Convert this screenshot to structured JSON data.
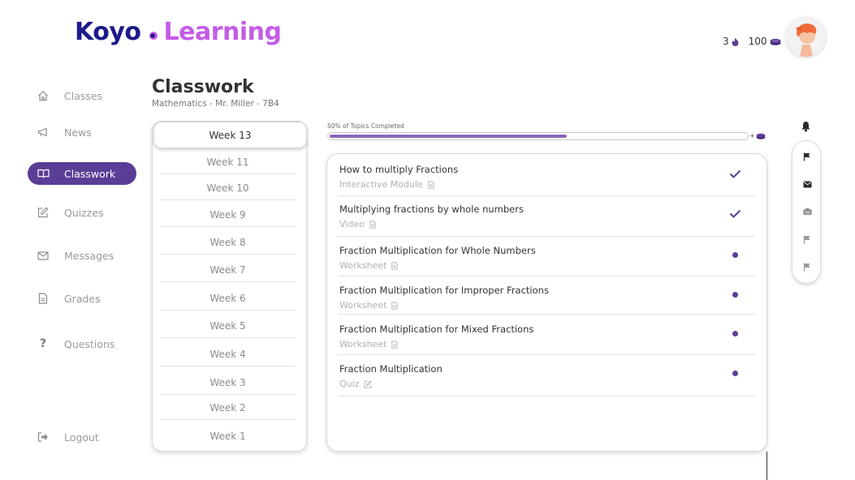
{
  "brand": {
    "part1": "Koyo",
    "part2": "Learning",
    "color1": "#1d1a8c",
    "color2": "#c35ce6"
  },
  "header": {
    "streak": "3",
    "streak_icon": "flame-icon",
    "coins": "100",
    "coin_icon": "coin-icon"
  },
  "sidebar": {
    "items": [
      {
        "label": "Classes",
        "icon": "home-icon",
        "active": false
      },
      {
        "label": "News",
        "icon": "megaphone-icon",
        "active": false
      },
      {
        "label": "Classwork",
        "icon": "book-icon",
        "active": true
      },
      {
        "label": "Quizzes",
        "icon": "edit-icon",
        "active": false
      },
      {
        "label": "Messages",
        "icon": "envelope-icon",
        "active": false
      },
      {
        "label": "Grades",
        "icon": "document-icon",
        "active": false
      },
      {
        "label": "Questions",
        "icon": "question-icon",
        "active": false
      }
    ],
    "logout": "Logout"
  },
  "page": {
    "title": "Classwork",
    "subtitle": "Mathematics - Mr. Miller  - 7B4"
  },
  "weeks": [
    "Week 13",
    "Week 11",
    "Week 10",
    "Week 9",
    "Week 8",
    "Week 7",
    "Week 6",
    "Week 5",
    "Week 4",
    "Week 3",
    "Week 2",
    "Week 1"
  ],
  "progress": {
    "label": "50% of Topics Completed",
    "fraction": 0.5,
    "reward_label": "+"
  },
  "topics": [
    {
      "title": "How to multiply Fractions",
      "type": "Interactive Module",
      "type_icon": "document-icon",
      "status": "completed"
    },
    {
      "title": "Multiplying fractions by whole numbers",
      "type": "Video",
      "type_icon": "document-icon",
      "status": "completed"
    },
    {
      "title": "Fraction Multiplication for Whole Numbers",
      "type": "Worksheet",
      "type_icon": "document-icon",
      "status": "pending"
    },
    {
      "title": "Fraction Multiplication for Improper Fractions",
      "type": "Worksheet",
      "type_icon": "document-icon",
      "status": "pending"
    },
    {
      "title": "Fraction Multiplication for Mixed Fractions",
      "type": "Worksheet",
      "type_icon": "document-icon",
      "status": "pending"
    },
    {
      "title": "Fraction Multiplication",
      "type": "Quiz",
      "type_icon": "edit-icon",
      "status": "pending"
    }
  ],
  "toolbar": [
    "bell-icon",
    "flag-icon",
    "envelope-icon",
    "coin-icon",
    "flag-icon",
    "flag-icon"
  ],
  "colors": {
    "accent": "#5a3e96",
    "progress": "#8a68b8"
  }
}
